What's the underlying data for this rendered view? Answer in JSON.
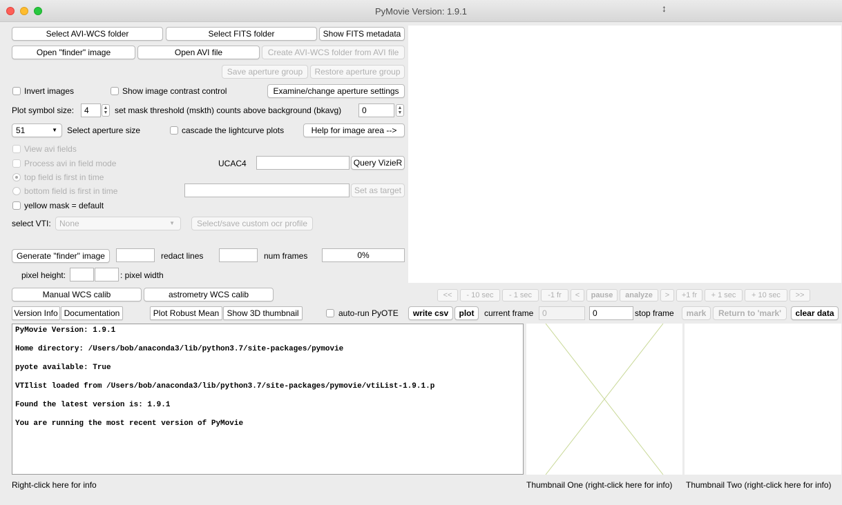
{
  "window": {
    "title": "PyMovie  Version: 1.9.1"
  },
  "buttons": {
    "select_avi_wcs": "Select AVI-WCS folder",
    "select_fits": "Select FITS folder",
    "show_fits_meta": "Show FITS metadata",
    "open_finder": "Open \"finder\" image",
    "open_avi": "Open AVI file",
    "create_avi_wcs": "Create AVI-WCS folder from AVI file",
    "save_aperture": "Save aperture group",
    "restore_aperture": "Restore aperture group",
    "examine_aperture": "Examine/change aperture settings",
    "help_image_area": "Help for image area -->",
    "query_vizier": "Query VizieR",
    "set_as_target": "Set as target",
    "select_ocr_profile": "Select/save custom ocr profile",
    "generate_finder": "Generate \"finder\" image",
    "manual_wcs": "Manual WCS calib",
    "astrometry_wcs": "astrometry WCS calib",
    "version_info": "Version Info",
    "documentation": "Documentation",
    "plot_robust_mean": "Plot Robust Mean",
    "show_3d_thumb": "Show 3D thumbnail",
    "write_csv": "write csv",
    "plot": "plot",
    "mark": "mark",
    "return_to_mark": "Return to 'mark'",
    "clear_data": "clear data"
  },
  "checkboxes": {
    "invert_images": "Invert images",
    "show_contrast": "Show image contrast control",
    "cascade_plots": "cascade the lightcurve plots",
    "view_avi_fields": "View avi fields",
    "process_field_mode": "Process avi in field mode",
    "yellow_mask": "yellow mask = default",
    "auto_run_pyote": "auto-run PyOTE"
  },
  "radios": {
    "top_field_first": "top field is first in time",
    "bottom_field_first": "bottom field is first in time"
  },
  "labels": {
    "plot_symbol_size": "Plot symbol size:",
    "mask_threshold": "set mask threshold (mskth) counts above background (bkavg)",
    "select_aperture_size": "Select aperture size",
    "ucac4": "UCAC4",
    "select_vti": "select VTI:",
    "redact_lines": "redact lines",
    "num_frames": "num frames",
    "pixel_height": "pixel height:",
    "pixel_width": ": pixel width",
    "current_frame": "current frame",
    "stop_frame": "stop frame",
    "log_info": "Right-click here for info",
    "thumb_one": "Thumbnail One (right-click here for info)",
    "thumb_two": "Thumbnail Two (right-click here for info)"
  },
  "fields": {
    "plot_symbol_size": "4",
    "mask_threshold": "0",
    "aperture_size": "51",
    "vti": "None",
    "progress": "0%",
    "current_frame": "0",
    "stop_frame": "0"
  },
  "nav": [
    "<<",
    "- 10 sec",
    "- 1 sec",
    "-1 fr",
    "<",
    "pause",
    "analyze",
    ">",
    "+1 fr",
    "+ 1 sec",
    "+ 10 sec",
    ">>"
  ],
  "log": [
    "PyMovie  Version: 1.9.1",
    "Home directory: /Users/bob/anaconda3/lib/python3.7/site-packages/pymovie",
    "pyote available: True",
    "VTIlist loaded from /Users/bob/anaconda3/lib/python3.7/site-packages/pymovie/vtiList-1.9.1.p",
    "Found the latest version is: 1.9.1",
    "You are running the most recent version of PyMovie"
  ]
}
